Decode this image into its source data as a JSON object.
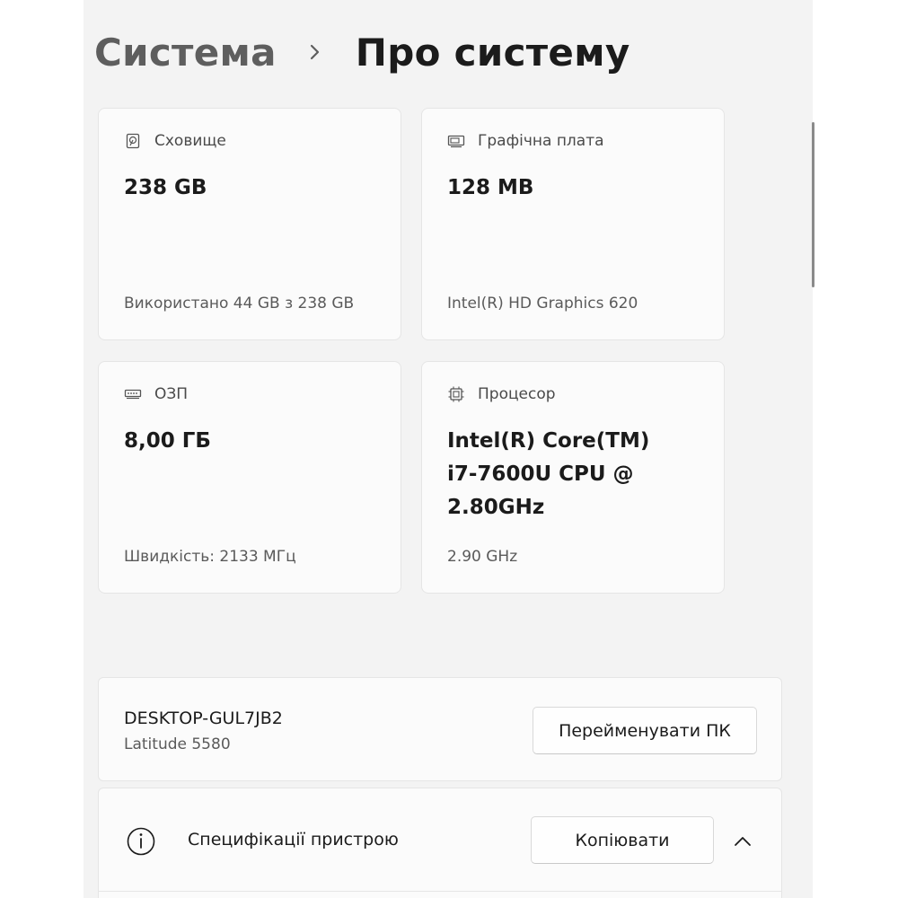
{
  "breadcrumb": {
    "parent": "Система",
    "current": "Про систему"
  },
  "cards": {
    "storage": {
      "icon": "hard-drive-icon",
      "label": "Сховище",
      "value": "238 GB",
      "detail": "Використано 44 GB з 238 GB"
    },
    "graphics": {
      "icon": "graphics-card-icon",
      "label": "Графічна плата",
      "value": "128 MB",
      "detail": "Intel(R) HD Graphics 620"
    },
    "ram": {
      "icon": "memory-icon",
      "label": "ОЗП",
      "value": "8,00 ГБ",
      "detail": "Швидкість: 2133 МГц"
    },
    "processor": {
      "icon": "processor-icon",
      "label": "Процесор",
      "value": "Intel(R) Core(TM)\ni7-7600U CPU @\n2.80GHz",
      "detail": "2.90 GHz"
    }
  },
  "device": {
    "name": "DESKTOP-GUL7JB2",
    "model": "Latitude 5580",
    "rename_label": "Перейменувати ПК"
  },
  "specs": {
    "icon": "info-icon",
    "title": "Специфікації пристрою",
    "copy_label": "Копіювати",
    "expanded": true
  },
  "colors": {
    "background": "#f3f3f3",
    "card": "#fbfbfb",
    "border": "#e5e5e5",
    "text": "#1b1b1b",
    "secondary_text": "#5a5a5a"
  }
}
